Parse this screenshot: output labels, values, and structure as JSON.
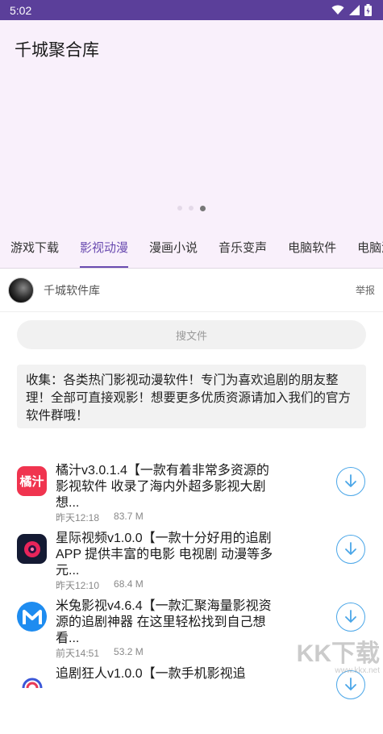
{
  "status": {
    "time": "5:02"
  },
  "app": {
    "title": "千城聚合库"
  },
  "carousel": {
    "dot_count": 3,
    "active_index": 2
  },
  "tabs": [
    {
      "label": "游戏下载",
      "active": false
    },
    {
      "label": "影视动漫",
      "active": true
    },
    {
      "label": "漫画小说",
      "active": false
    },
    {
      "label": "音乐变声",
      "active": false
    },
    {
      "label": "电脑软件",
      "active": false
    },
    {
      "label": "电脑游",
      "active": false
    }
  ],
  "author": {
    "name": "千城软件库",
    "report_label": "举报"
  },
  "search": {
    "placeholder": "搜文件"
  },
  "notice": {
    "text": "收集：各类热门影视动漫软件！专门为喜欢追剧的朋友整理！全部可直接观影！想要更多优质资源请加入我们的官方软件群哦！"
  },
  "files": [
    {
      "title": "橘汁v3.0.1.4【一款有着非常多资源的影视软件 收录了海内外超多影视大剧 想...",
      "time": "昨天12:18",
      "size": "83.7 M",
      "icon": "juzhi-app-icon",
      "icon_text": "橘汁",
      "icon_color": "#f0344f"
    },
    {
      "title": "星际视频v1.0.0【一款十分好用的追剧APP 提供丰富的电影 电视剧 动漫等多元...",
      "time": "昨天12:10",
      "size": "68.4 M",
      "icon": "xingji-app-icon",
      "icon_text": "",
      "icon_color": "#141a33"
    },
    {
      "title": "米兔影视v4.6.4【一款汇聚海量影视资源的追剧神器 在这里轻松找到自己想看...",
      "time": "前天14:51",
      "size": "53.2 M",
      "icon": "mitu-app-icon",
      "icon_text": "",
      "icon_color": "#1e8cf0"
    },
    {
      "title": "追剧狂人v1.0.0【一款手机影视追",
      "time": "",
      "size": "",
      "icon": "zhuiju-app-icon",
      "icon_text": "",
      "icon_color": "#ffffff"
    }
  ],
  "watermark": {
    "text": "KK下载",
    "url": "www.kkx.net"
  }
}
